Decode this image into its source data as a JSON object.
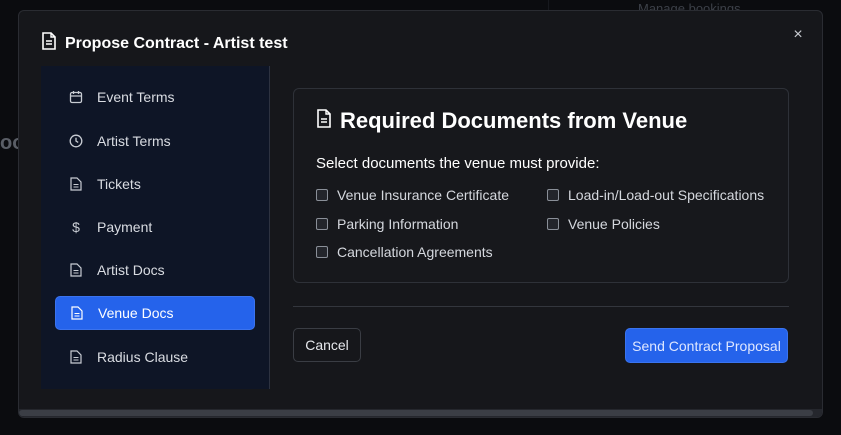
{
  "background": {
    "top_right_hint": "Manage bookings",
    "left_hint": "oo"
  },
  "modal": {
    "title": "Propose Contract - Artist test",
    "close_label": "×"
  },
  "sidebar": {
    "items": [
      {
        "label": "Event Terms",
        "icon": "calendar-icon",
        "active": false
      },
      {
        "label": "Artist Terms",
        "icon": "clock-icon",
        "active": false
      },
      {
        "label": "Tickets",
        "icon": "document-icon",
        "active": false
      },
      {
        "label": "Payment",
        "icon": "dollar-icon",
        "active": false
      },
      {
        "label": "Artist Docs",
        "icon": "document-icon",
        "active": false
      },
      {
        "label": "Venue Docs",
        "icon": "document-icon",
        "active": true
      },
      {
        "label": "Radius Clause",
        "icon": "document-icon",
        "active": false
      }
    ]
  },
  "section": {
    "title": "Required Documents from Venue",
    "subtitle": "Select documents the venue must provide:",
    "documents": [
      {
        "label": "Venue Insurance Certificate",
        "checked": false
      },
      {
        "label": "Load-in/Load-out Specifications",
        "checked": false
      },
      {
        "label": "Parking Information",
        "checked": false
      },
      {
        "label": "Venue Policies",
        "checked": false
      },
      {
        "label": "Cancellation Agreements",
        "checked": false
      }
    ]
  },
  "footer": {
    "cancel_label": "Cancel",
    "send_label": "Send Contract Proposal"
  },
  "colors": {
    "accent": "#2563eb",
    "sidebar_bg": "#0e1526",
    "modal_bg": "#16171b"
  }
}
